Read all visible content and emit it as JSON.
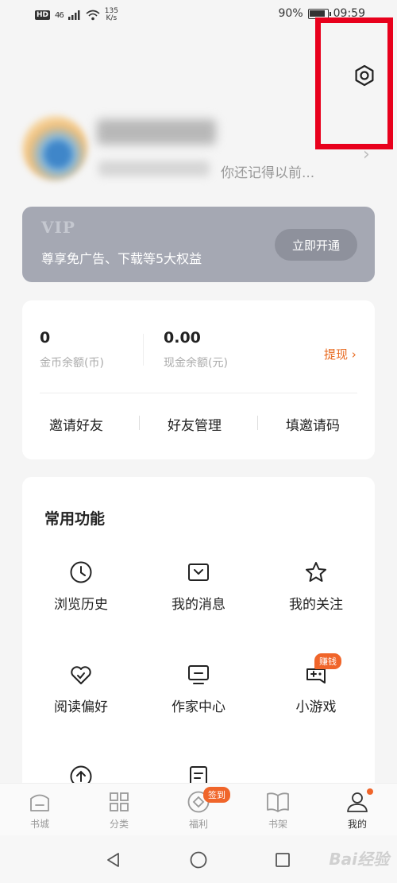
{
  "status": {
    "hd": "HD",
    "network": "46",
    "speed_value": "135",
    "speed_unit": "K/s",
    "battery": "90%",
    "time": "09:59"
  },
  "profile": {
    "recall_text": "你还记得以前..."
  },
  "vip": {
    "title": "VIP",
    "description": "尊享免广告、下载等5大权益",
    "button": "立即开通"
  },
  "wallet": {
    "coin_value": "0",
    "coin_label": "金币余额(币)",
    "cash_value": "0.00",
    "cash_label": "现金余额(元)",
    "withdraw": "提现 ›",
    "actions": [
      "邀请好友",
      "好友管理",
      "填邀请码"
    ]
  },
  "functions": {
    "title": "常用功能",
    "items": [
      {
        "label": "浏览历史",
        "icon": "clock-icon"
      },
      {
        "label": "我的消息",
        "icon": "message-icon"
      },
      {
        "label": "我的关注",
        "icon": "star-icon"
      },
      {
        "label": "阅读偏好",
        "icon": "heart-icon"
      },
      {
        "label": "作家中心",
        "icon": "monitor-icon"
      },
      {
        "label": "小游戏",
        "icon": "gamepad-icon"
      }
    ],
    "earn_badge": "赚钱"
  },
  "tabs": [
    {
      "label": "书城",
      "icon": "bookstore-icon"
    },
    {
      "label": "分类",
      "icon": "grid-icon"
    },
    {
      "label": "福利",
      "icon": "welfare-icon"
    },
    {
      "label": "书架",
      "icon": "book-icon"
    },
    {
      "label": "我的",
      "icon": "user-icon"
    }
  ],
  "sign_badge": "签到",
  "watermark": "Bai经验",
  "colors": {
    "accent": "#f0652a",
    "vip_bg": "#a5a8b3",
    "highlight": "#e8001c"
  }
}
